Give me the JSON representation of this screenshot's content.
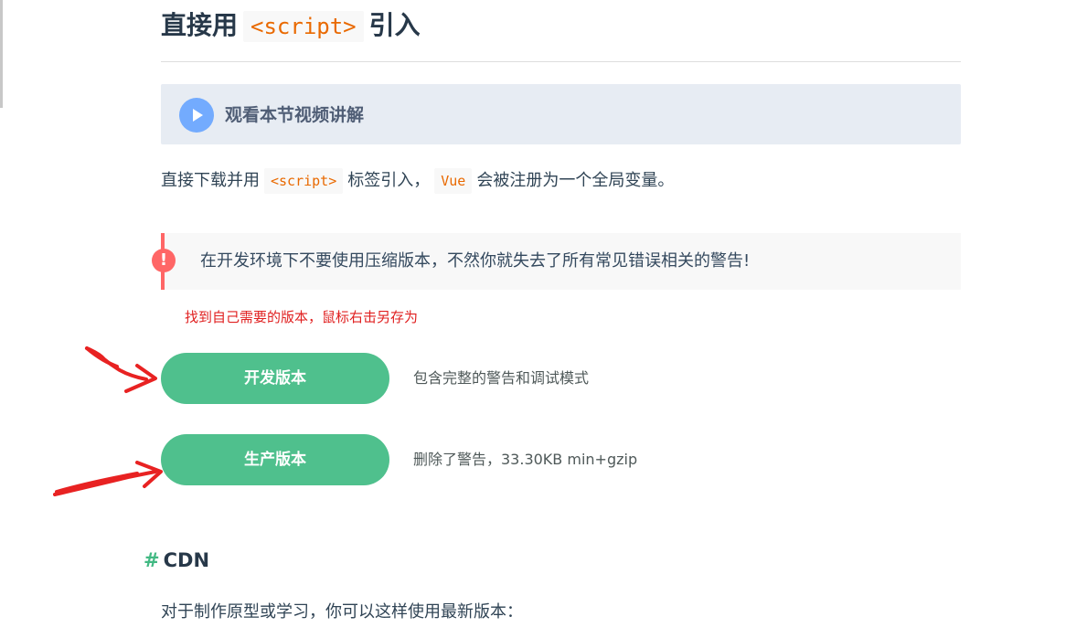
{
  "header": {
    "title_prefix": "直接用",
    "title_code": "<script>",
    "title_suffix": "引入"
  },
  "video": {
    "label": "观看本节视频讲解",
    "icon": "play-icon",
    "icon_color": "#73abfe"
  },
  "intro": {
    "part1": "直接下载并用",
    "code1": "<script>",
    "part2": "标签引入，",
    "code2": "Vue",
    "part3": "会被注册为一个全局变量。"
  },
  "tip": {
    "icon_text": "!",
    "text": "在开发环境下不要使用压缩版本，不然你就失去了所有常见错误相关的警告!",
    "accent": "#ff6666"
  },
  "annotation": {
    "text": "找到自己需要的版本，鼠标右击另存为",
    "color": "#e02020"
  },
  "downloads": [
    {
      "label": "开发版本",
      "description": "包含完整的警告和调试模式"
    },
    {
      "label": "生产版本",
      "description": "删除了警告，33.30KB min+gzip"
    }
  ],
  "cdn": {
    "hash": "#",
    "heading": "CDN",
    "text": "对于制作原型或学习，你可以这样使用最新版本："
  },
  "colors": {
    "brand_green": "#4fc08d",
    "code_orange": "#e96900",
    "annotation_red": "#e02020"
  }
}
